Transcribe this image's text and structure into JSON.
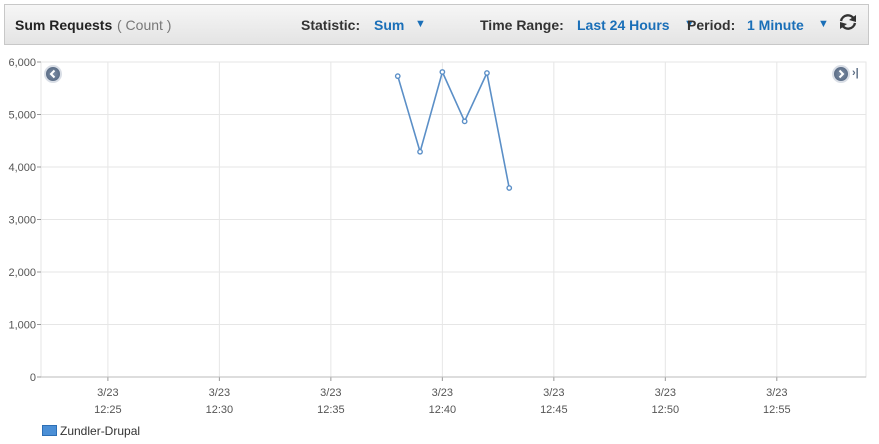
{
  "header": {
    "title": "Sum Requests",
    "unit": "( Count )",
    "statistic_label": "Statistic:",
    "statistic_value": "Sum",
    "time_range_label": "Time Range:",
    "time_range_value": "Last 24 Hours",
    "period_label": "Period:",
    "period_value": "1 Minute"
  },
  "colors": {
    "series": "#5b8fc7",
    "accent": "#1a6fb8",
    "grid": "#e6e6e6"
  },
  "chart_data": {
    "type": "line",
    "title": "Sum Requests",
    "ylabel": "",
    "xlabel": "",
    "ylim": [
      0,
      6000
    ],
    "yticks": [
      0,
      1000,
      2000,
      3000,
      4000,
      5000,
      6000
    ],
    "ytick_labels": [
      "0",
      "1,000",
      "2,000",
      "3,000",
      "4,000",
      "5,000",
      "6,000"
    ],
    "xlim": [
      "12:22",
      "12:59"
    ],
    "xticks": [
      "12:25",
      "12:30",
      "12:35",
      "12:40",
      "12:45",
      "12:50",
      "12:55"
    ],
    "xtick_date": "3/23",
    "grid": true,
    "legend_position": "bottom-left",
    "series": [
      {
        "name": "Zundler-Drupal",
        "color": "#5b8fc7",
        "x": [
          "12:38",
          "12:39",
          "12:40",
          "12:41",
          "12:42",
          "12:43"
        ],
        "y": [
          5730,
          4290,
          5810,
          4870,
          5790,
          3600
        ]
      }
    ]
  }
}
